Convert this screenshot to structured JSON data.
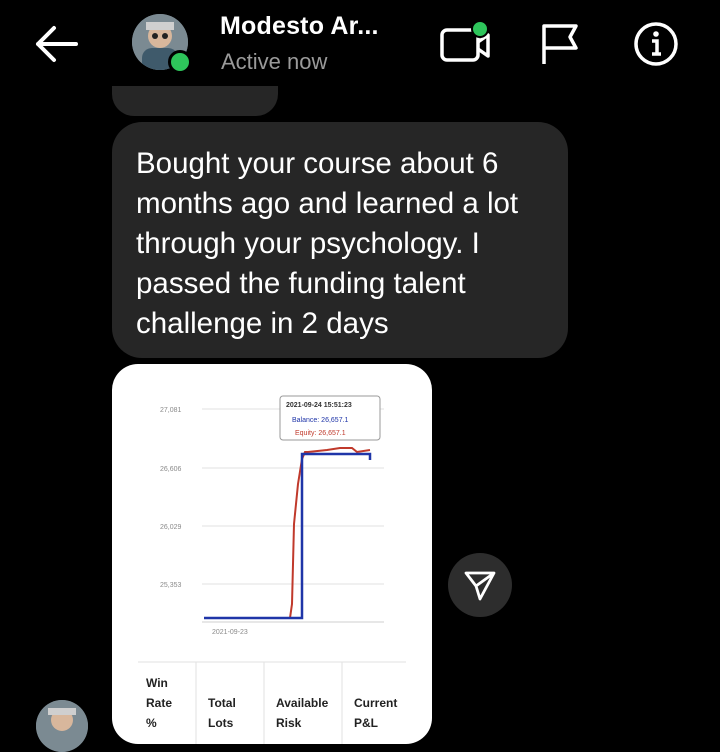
{
  "header": {
    "contact_name": "Modesto Ar...",
    "status": "Active now",
    "colors": {
      "online": "#2ec55b",
      "status_text": "#9a9a9a"
    },
    "icons": [
      "back-arrow-icon",
      "video-call-icon",
      "flag-icon",
      "info-icon"
    ]
  },
  "messages": [
    {
      "text": "Bought your course about 6 months ago and learned a lot through your psychology. I passed the funding talent challenge in 2 days"
    }
  ],
  "shared_image": {
    "chart": {
      "y_ticks": [
        "27,081",
        "26,606",
        "26,029",
        "25,353"
      ],
      "x_label": "2021-09-23",
      "tooltip": {
        "time": "2021-09-24 15:51:23",
        "balance": "Balance: 26,657.1",
        "equity": "Equity: 26,657.1"
      }
    },
    "table_headers": [
      [
        "Win",
        "Rate",
        "%"
      ],
      [
        "Total",
        "Lots"
      ],
      [
        "Available",
        "Risk"
      ],
      [
        "Current",
        "P&L"
      ]
    ]
  }
}
